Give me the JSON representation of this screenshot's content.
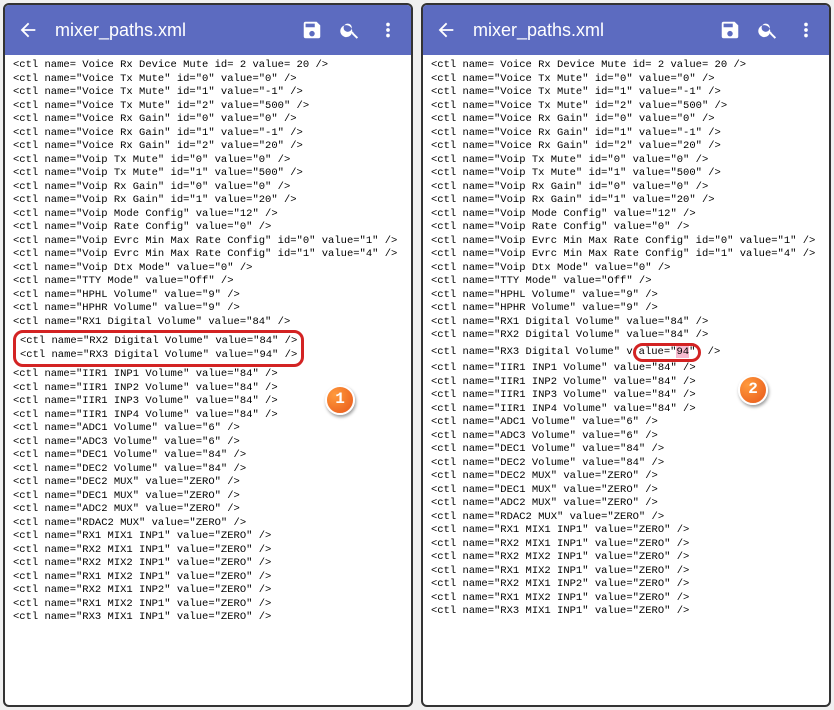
{
  "title": "mixer_paths.xml",
  "badge1": "1",
  "badge2": "2",
  "lines_top": [
    "<ctl name= Voice Rx Device Mute  id= 2  value= 20  />",
    "<ctl name=\"Voice Tx Mute\" id=\"0\" value=\"0\" />",
    "<ctl name=\"Voice Tx Mute\" id=\"1\" value=\"-1\" />",
    "<ctl name=\"Voice Tx Mute\" id=\"2\" value=\"500\" />",
    "<ctl name=\"Voice Rx Gain\" id=\"0\" value=\"0\" />",
    "<ctl name=\"Voice Rx Gain\" id=\"1\" value=\"-1\" />",
    "<ctl name=\"Voice Rx Gain\" id=\"2\" value=\"20\" />",
    "<ctl name=\"Voip Tx Mute\" id=\"0\" value=\"0\" />",
    "<ctl name=\"Voip Tx Mute\" id=\"1\" value=\"500\" />",
    "<ctl name=\"Voip Rx Gain\" id=\"0\" value=\"0\" />",
    "<ctl name=\"Voip Rx Gain\" id=\"1\" value=\"20\" />",
    "<ctl name=\"Voip Mode Config\" value=\"12\" />",
    "<ctl name=\"Voip Rate Config\" value=\"0\" />",
    "<ctl name=\"Voip Evrc Min Max Rate Config\" id=\"0\" value=\"1\" />",
    "<ctl name=\"Voip Evrc Min Max Rate Config\" id=\"1\" value=\"4\" />",
    "<ctl name=\"Voip Dtx Mode\" value=\"0\" />",
    "<ctl name=\"TTY Mode\" value=\"Off\" />",
    "<ctl name=\"HPHL Volume\" value=\"9\" />",
    "<ctl name=\"HPHR Volume\" value=\"9\" />",
    "<ctl name=\"RX1 Digital Volume\" value=\"84\" />"
  ],
  "rx2_left": "<ctl name=\"RX2 Digital Volume\" value=\"84\" />",
  "rx3_left": "<ctl name=\"RX3 Digital Volume\" value=\"94\" />",
  "rx2_right": "<ctl name=\"RX2 Digital Volume\" value=\"84\" />",
  "rx3_right_pre": "<ctl name=\"RX3 Digital Volume\"  v",
  "rx3_right_mid1": "alue=\"",
  "rx3_right_val": "94",
  "rx3_right_mid2": "\"",
  "rx3_right_post": " />",
  "iir1_left": "<ctl name=\"IIR1 INP1 Volume\" value=\"84\" />",
  "iir1_right": "<ctl name=\"IIR1 INP1 Volume\" value=\"84\" />",
  "lines_bottom": [
    "<ctl name=\"IIR1 INP2 Volume\" value=\"84\" />",
    "<ctl name=\"IIR1 INP3 Volume\" value=\"84\" />",
    "<ctl name=\"IIR1 INP4 Volume\" value=\"84\" />",
    "<ctl name=\"ADC1 Volume\" value=\"6\" />",
    "<ctl name=\"ADC3 Volume\" value=\"6\" />",
    "<ctl name=\"DEC1 Volume\" value=\"84\" />",
    "<ctl name=\"DEC2 Volume\" value=\"84\" />",
    "<ctl name=\"DEC2 MUX\" value=\"ZERO\" />",
    "<ctl name=\"DEC1 MUX\" value=\"ZERO\" />",
    "<ctl name=\"ADC2 MUX\" value=\"ZERO\" />",
    "<ctl name=\"RDAC2 MUX\" value=\"ZERO\" />",
    "<ctl name=\"RX1 MIX1 INP1\" value=\"ZERO\" />",
    "<ctl name=\"RX2 MIX1 INP1\" value=\"ZERO\" />",
    "<ctl name=\"RX2 MIX2 INP1\" value=\"ZERO\" />",
    "<ctl name=\"RX1 MIX2 INP1\" value=\"ZERO\" />",
    "<ctl name=\"RX2 MIX1 INP2\" value=\"ZERO\" />",
    "<ctl name=\"RX1 MIX2 INP1\" value=\"ZERO\" />",
    "<ctl name=\"RX3 MIX1 INP1\" value=\"ZERO\" />"
  ]
}
